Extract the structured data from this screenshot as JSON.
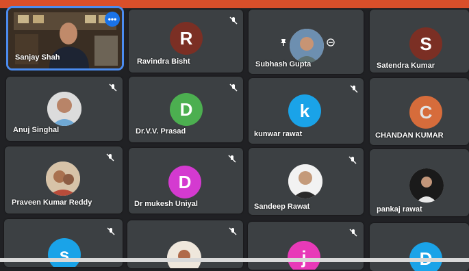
{
  "participants": [
    {
      "name": "Sanjay Shah"
    },
    {
      "name": "Ravindra Bisht",
      "initial": "R",
      "color": "#7b2f24"
    },
    {
      "name": "Subhash Gupta"
    },
    {
      "name": "Satendra Kumar",
      "initial": "S",
      "color": "#7b2f24"
    },
    {
      "name": "Anuj Singhal"
    },
    {
      "name": "Dr.V.V. Prasad",
      "initial": "D",
      "color": "#4caf50"
    },
    {
      "name": "kunwar rawat",
      "initial": "k",
      "color": "#1aa3e8"
    },
    {
      "name": "CHANDAN KUMAR",
      "initial": "C",
      "color": "#f2743a"
    },
    {
      "name": "Praveen Kumar Reddy"
    },
    {
      "name": "Dr mukesh Uniyal",
      "initial": "D",
      "color": "#d43ad0"
    },
    {
      "name": "Sandeep Rawat"
    },
    {
      "name": "pankaj rawat"
    },
    {
      "initial": "s",
      "color": "#1aa3e8"
    },
    {},
    {
      "initial": "j",
      "color": "#e83ab8"
    },
    {
      "initial": "D",
      "color": "#1aa3e8"
    }
  ],
  "colors": {
    "accent": "#4b8cf0",
    "banner": "#d94f2a",
    "tile": "#3c4043"
  },
  "icons": {
    "muted": "mic-off-icon",
    "more": "more-options-icon",
    "pin": "pin-icon",
    "remove": "remove-icon"
  }
}
